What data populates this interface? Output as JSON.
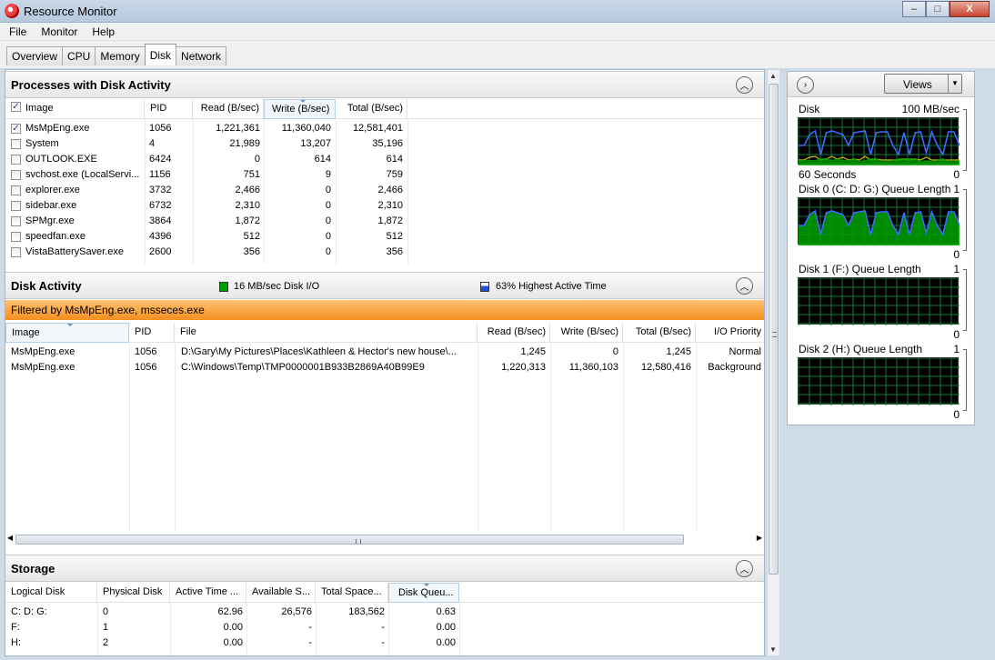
{
  "window": {
    "title": "Resource Monitor",
    "buttons": {
      "minimize": "–",
      "maximize": "□",
      "close": "X"
    }
  },
  "menu": [
    "File",
    "Monitor",
    "Help"
  ],
  "tabs": [
    "Overview",
    "CPU",
    "Memory",
    "Disk",
    "Network"
  ],
  "active_tab": "Disk",
  "processes": {
    "title": "Processes with Disk Activity",
    "columns": [
      "Image",
      "PID",
      "Read (B/sec)",
      "Write (B/sec)",
      "Total (B/sec)"
    ],
    "header_checked": true,
    "sorted_column": "Write (B/sec)",
    "rows": [
      {
        "checked": true,
        "image": "MsMpEng.exe",
        "pid": "1056",
        "read": "1,221,361",
        "write": "11,360,040",
        "total": "12,581,401"
      },
      {
        "checked": false,
        "image": "System",
        "pid": "4",
        "read": "21,989",
        "write": "13,207",
        "total": "35,196"
      },
      {
        "checked": false,
        "image": "OUTLOOK.EXE",
        "pid": "6424",
        "read": "0",
        "write": "614",
        "total": "614"
      },
      {
        "checked": false,
        "image": "svchost.exe (LocalServi...",
        "pid": "1156",
        "read": "751",
        "write": "9",
        "total": "759"
      },
      {
        "checked": false,
        "image": "explorer.exe",
        "pid": "3732",
        "read": "2,466",
        "write": "0",
        "total": "2,466"
      },
      {
        "checked": false,
        "image": "sidebar.exe",
        "pid": "6732",
        "read": "2,310",
        "write": "0",
        "total": "2,310"
      },
      {
        "checked": false,
        "image": "SPMgr.exe",
        "pid": "3864",
        "read": "1,872",
        "write": "0",
        "total": "1,872"
      },
      {
        "checked": false,
        "image": "speedfan.exe",
        "pid": "4396",
        "read": "512",
        "write": "0",
        "total": "512"
      },
      {
        "checked": false,
        "image": "VistaBatterySaver.exe",
        "pid": "2600",
        "read": "356",
        "write": "0",
        "total": "356"
      }
    ]
  },
  "disk_activity": {
    "title": "Disk Activity",
    "legend_io": "16 MB/sec Disk I/O",
    "legend_active": "63% Highest Active Time",
    "filter": "Filtered by MsMpEng.exe, msseces.exe",
    "columns": [
      "Image",
      "PID",
      "File",
      "Read (B/sec)",
      "Write (B/sec)",
      "Total (B/sec)",
      "I/O Priority"
    ],
    "rows": [
      {
        "image": "MsMpEng.exe",
        "pid": "1056",
        "file": "D:\\Gary\\My Pictures\\Places\\Kathleen & Hector's new house\\...",
        "read": "1,245",
        "write": "0",
        "total": "1,245",
        "priority": "Normal"
      },
      {
        "image": "MsMpEng.exe",
        "pid": "1056",
        "file": "C:\\Windows\\Temp\\TMP0000001B933B2869A40B99E9",
        "read": "1,220,313",
        "write": "11,360,103",
        "total": "12,580,416",
        "priority": "Background"
      }
    ]
  },
  "storage": {
    "title": "Storage",
    "columns": [
      "Logical Disk",
      "Physical Disk",
      "Active Time ...",
      "Available S...",
      "Total Space...",
      "Disk Queu..."
    ],
    "rows": [
      {
        "logical": "C: D: G:",
        "physical": "0",
        "active": "62.96",
        "available": "26,576",
        "total": "183,562",
        "queue": "0.63"
      },
      {
        "logical": "F:",
        "physical": "1",
        "active": "0.00",
        "available": "-",
        "total": "-",
        "queue": "0.00"
      },
      {
        "logical": "H:",
        "physical": "2",
        "active": "0.00",
        "available": "-",
        "total": "-",
        "queue": "0.00"
      }
    ]
  },
  "right_pane": {
    "views_label": "Views",
    "graphs": [
      {
        "title": "Disk",
        "scale": "100 MB/sec",
        "foot_left": "60 Seconds",
        "foot_right": "0"
      },
      {
        "title": "Disk 0 (C: D: G:) Queue Length",
        "scale": "1",
        "foot_left": "",
        "foot_right": "0"
      },
      {
        "title": "Disk 1 (F:) Queue Length",
        "scale": "1",
        "foot_left": "",
        "foot_right": "0"
      },
      {
        "title": "Disk 2 (H:) Queue Length",
        "scale": "1",
        "foot_left": "",
        "foot_right": "0"
      }
    ]
  },
  "colors": {
    "graph_bg": "#000000",
    "grid": "#0f7a3a",
    "line_blue": "#3b6cff",
    "line_yellow": "#c8c800",
    "fill_green": "#00a000",
    "filter_orange": "#f5962b"
  }
}
